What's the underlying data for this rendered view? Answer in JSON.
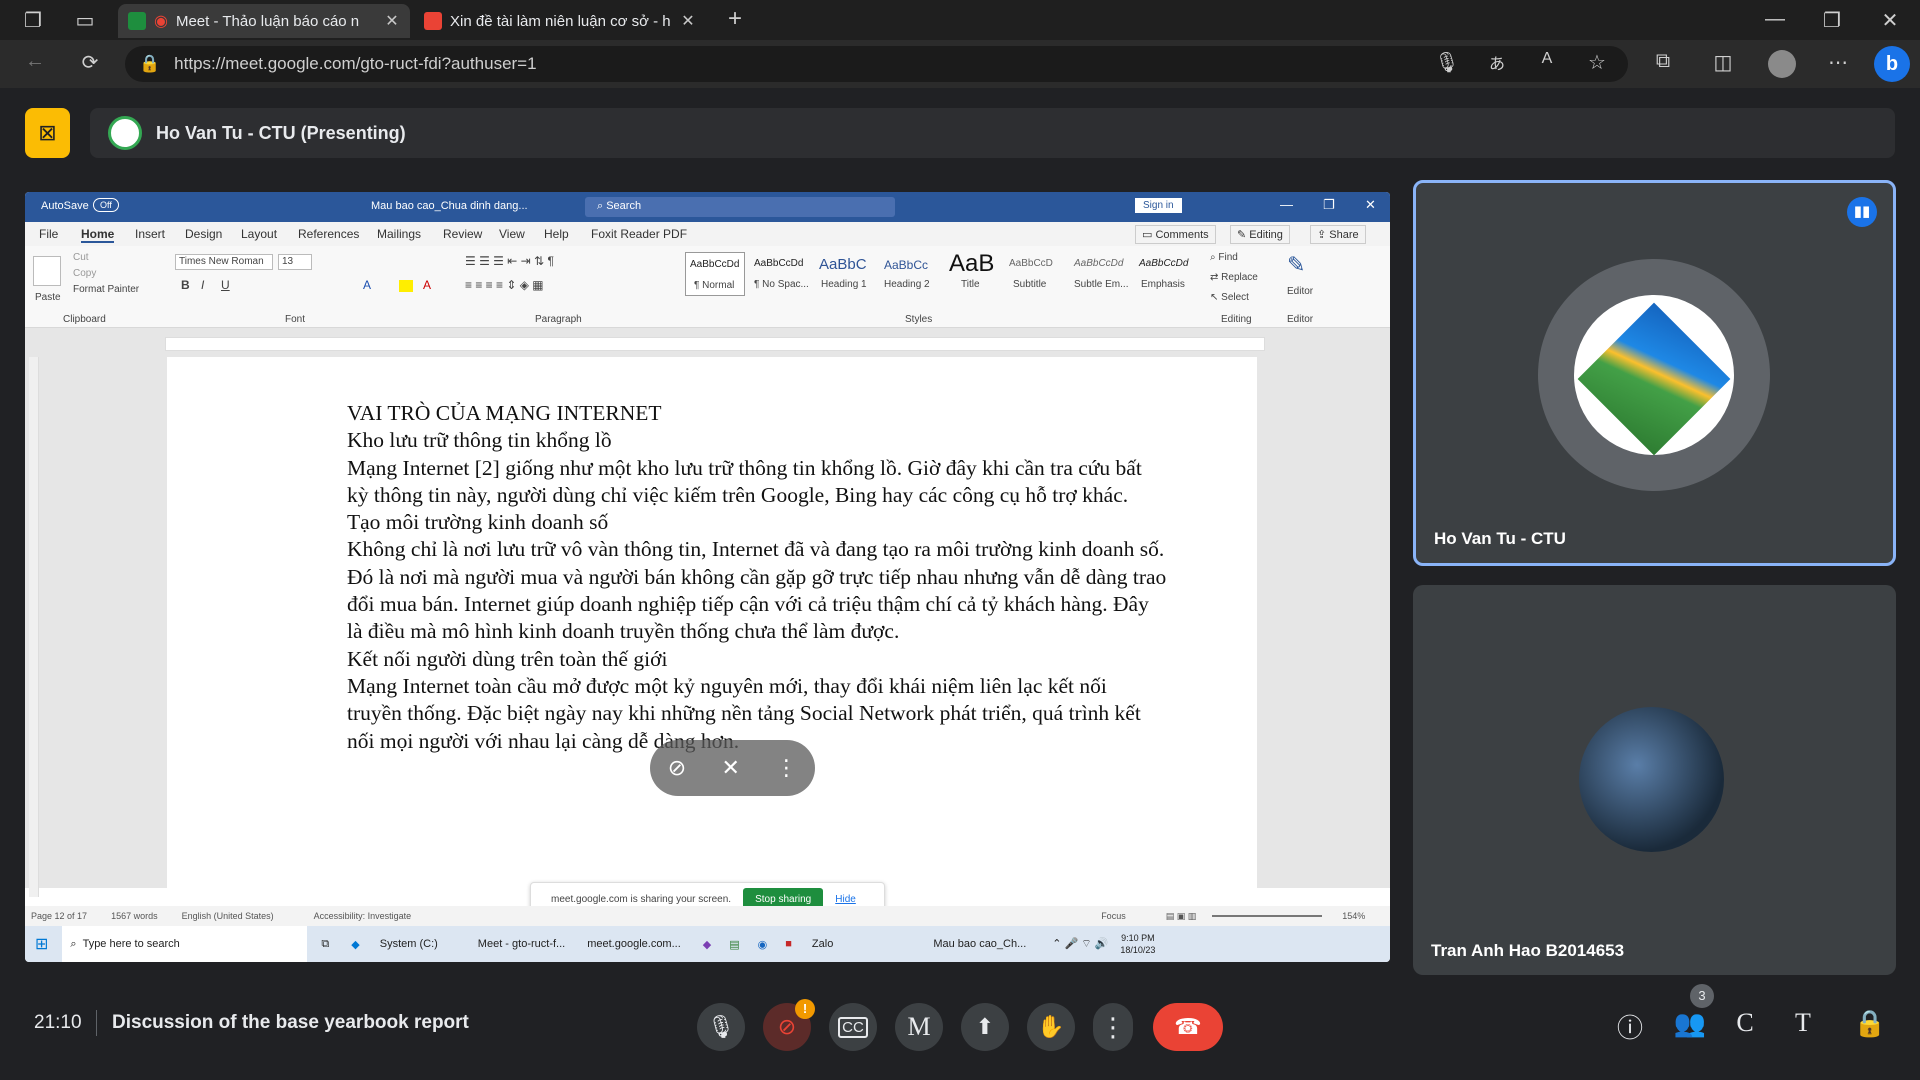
{
  "browser": {
    "tabs": [
      {
        "title": "Meet - Thảo luận báo cáo n",
        "active": true
      },
      {
        "title": "Xin đề tài làm niên luận cơ sở - h",
        "active": false
      }
    ],
    "new_tab": "+",
    "url": "https://meet.google.com/gto-ruct-fdi?authuser=1",
    "window_controls": [
      "—",
      "❐",
      "✕"
    ]
  },
  "meet": {
    "presenter_banner": "Ho Van Tu - CTU (Presenting)",
    "participants": [
      {
        "name": "Ho Van Tu - CTU"
      },
      {
        "name": "Tran Anh Hao B2014653"
      }
    ],
    "clock": "21:10",
    "meeting_title": "Discussion of the base yearbook report",
    "people_count": "3",
    "controls": {
      "more": "⋮",
      "letter_m": "M",
      "letter_c": "C",
      "letter_t": "T",
      "warning": "!"
    }
  },
  "word": {
    "autosave": "AutoSave",
    "autosave_state": "Off",
    "doc_title": "Mau bao cao_Chua dinh dang...",
    "search": "Search",
    "sign_in": "Sign in",
    "ribbon_tabs": [
      "File",
      "Home",
      "Insert",
      "Design",
      "Layout",
      "References",
      "Mailings",
      "Review",
      "View",
      "Help",
      "Foxit Reader PDF"
    ],
    "comments": "Comments",
    "editing": "Editing",
    "share": "Share",
    "clipboard": {
      "paste": "Paste",
      "cut": "Cut",
      "copy": "Copy",
      "format_painter": "Format Painter",
      "group": "Clipboard"
    },
    "font": {
      "name": "Times New Roman",
      "size": "13",
      "group": "Font"
    },
    "paragraph_group": "Paragraph",
    "styles": [
      {
        "preview": "AaBbCcDd",
        "label": "¶ Normal"
      },
      {
        "preview": "AaBbCcDd",
        "label": "¶ No Spac..."
      },
      {
        "preview": "AaBbC",
        "label": "Heading 1"
      },
      {
        "preview": "AaBbCc",
        "label": "Heading 2"
      },
      {
        "preview": "AaB",
        "label": "Title"
      },
      {
        "preview": "AaBbCcD",
        "label": "Subtitle"
      },
      {
        "preview": "AaBbCcDd",
        "label": "Subtle Em..."
      },
      {
        "preview": "AaBbCcDd",
        "label": "Emphasis"
      }
    ],
    "styles_group": "Styles",
    "editing_group": {
      "find": "Find",
      "replace": "Replace",
      "select": "Select",
      "group": "Editing"
    },
    "editor": "Editor",
    "editor_group": "Editor",
    "doc_lines": [
      "VAI TRÒ CỦA MẠNG INTERNET",
      "Kho lưu trữ thông tin khổng lồ",
      "Mạng Internet [2] giống như một kho lưu trữ thông tin khổng lồ. Giờ đây khi cần tra cứu bất kỳ thông tin này, người dùng chỉ việc kiếm trên Google, Bing hay các công cụ hỗ trợ khác.",
      "Tạo môi trường kinh doanh số",
      "Không chỉ là nơi lưu trữ vô vàn thông tin, Internet đã và đang tạo ra môi trường kinh doanh số. Đó là nơi mà người mua và người bán không cần gặp gỡ trực tiếp nhau nhưng vẫn dễ dàng trao đổi mua bán. Internet giúp doanh nghiệp tiếp cận với cả triệu thậm chí cả tỷ khách hàng. Đây là điều mà mô hình kinh doanh truyền thống chưa thể làm được.",
      "Kết nối người dùng trên toàn thế giới",
      "Mạng Internet toàn cầu mở được một kỷ nguyên mới, thay đổi khái niệm liên lạc kết nối truyền thống. Đặc biệt ngày nay khi những nền tảng Social Network phát triển, quá trình kết nối mọi người với nhau lại càng dễ dàng hơn."
    ],
    "status": {
      "page": "Page 12 of 17",
      "words": "1567 words",
      "language": "English (United States)",
      "accessibility": "Accessibility: Investigate",
      "focus": "Focus",
      "zoom": "154%"
    },
    "share_notice": "meet.google.com is sharing your screen.",
    "stop_sharing": "Stop sharing",
    "hide": "Hide"
  },
  "taskbar": {
    "search": "Type here to search",
    "apps": [
      "System (C:)",
      "Meet - gto-ruct-f...",
      "meet.google.com...",
      "Zalo",
      "Mau bao cao_Ch..."
    ],
    "time": "9:10 PM",
    "date": "18/10/23"
  },
  "colors": {
    "bg": "#202124",
    "accent_blue": "#8ab4f8",
    "hangup": "#ea4335",
    "camera_off": "#d93025",
    "word_blue": "#2b579a",
    "yellow": "#fbbc04"
  }
}
